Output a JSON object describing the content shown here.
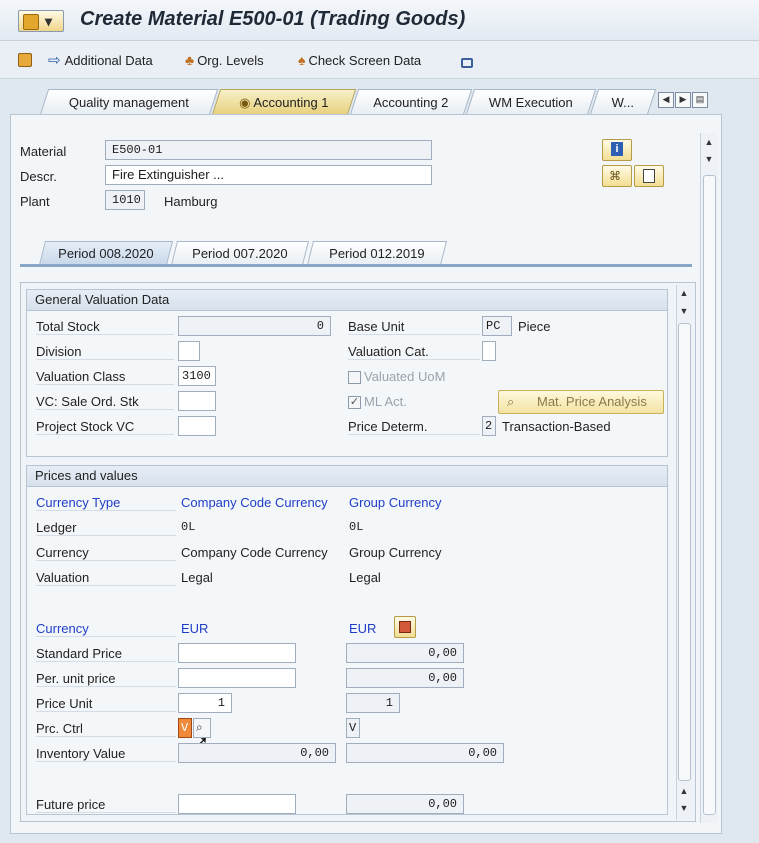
{
  "window": {
    "title": "Create Material E500-01 (Trading Goods)"
  },
  "toolbar": {
    "additional_data": "Additional Data",
    "org_levels": "Org. Levels",
    "check_screen_data": "Check Screen Data"
  },
  "tabs": [
    {
      "label": "Quality management"
    },
    {
      "label": "Accounting 1"
    },
    {
      "label": "Accounting 2"
    },
    {
      "label": "WM Execution"
    },
    {
      "label": "W..."
    }
  ],
  "header": {
    "material_label": "Material",
    "material_value": "E500-01",
    "descr_label": "Descr.",
    "descr_value": "Fire Extinguisher ...",
    "plant_label": "Plant",
    "plant_value": "1010",
    "plant_name": "Hamburg"
  },
  "period_tabs": [
    {
      "label": "Period 008.2020"
    },
    {
      "label": "Period 007.2020"
    },
    {
      "label": "Period 012.2019"
    }
  ],
  "general": {
    "title": "General Valuation Data",
    "total_stock_label": "Total Stock",
    "total_stock_value": "0",
    "division_label": "Division",
    "division_value": "",
    "valuation_class_label": "Valuation Class",
    "valuation_class_value": "3100",
    "vc_sale_label": "VC: Sale Ord. Stk",
    "project_stock_label": "Project Stock VC",
    "base_unit_label": "Base Unit",
    "base_unit_value": "PC",
    "base_unit_text": "Piece",
    "valuation_cat_label": "Valuation Cat.",
    "valuated_uom_label": "Valuated UoM",
    "ml_act_label": "ML Act.",
    "price_determ_label": "Price Determ.",
    "price_determ_value": "2",
    "price_determ_text": "Transaction-Based",
    "mat_price_analysis": "Mat. Price Analysis"
  },
  "prices": {
    "title": "Prices and values",
    "currency_type_label": "Currency Type",
    "company_code_currency_hdr": "Company Code Currency",
    "group_currency_hdr": "Group Currency",
    "ledger_label": "Ledger",
    "ledger_cc": "0L",
    "ledger_gc": "0L",
    "currency_row_label": "Currency",
    "currency_cc": "Company Code Currency",
    "currency_gc": "Group Currency",
    "valuation_label": "Valuation",
    "valuation_cc": "Legal",
    "valuation_gc": "Legal",
    "currency2_label": "Currency",
    "currency2_cc": "EUR",
    "currency2_gc": "EUR",
    "standard_price_label": "Standard Price",
    "standard_price_cc": "",
    "standard_price_gc": "0,00",
    "per_unit_label": "Per. unit price",
    "per_unit_cc": "",
    "per_unit_gc": "0,00",
    "price_unit_label": "Price Unit",
    "price_unit_cc": "1",
    "price_unit_gc": "1",
    "prc_ctrl_label": "Prc. Ctrl",
    "prc_ctrl_cc": "V",
    "prc_ctrl_gc": "V",
    "inventory_label": "Inventory Value",
    "inventory_cc": "0,00",
    "inventory_gc": "0,00",
    "future_price_label": "Future price",
    "future_price_cc": "",
    "future_price_gc": "0,00"
  }
}
